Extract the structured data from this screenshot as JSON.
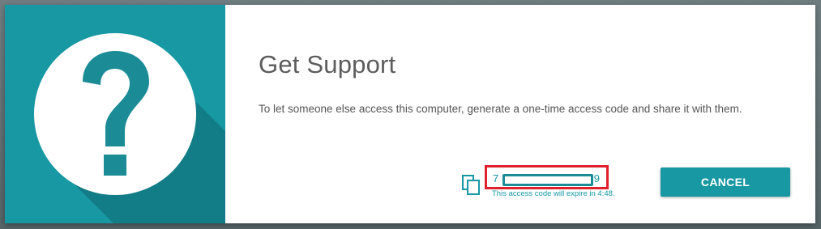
{
  "dialog": {
    "title": "Get Support",
    "description": "To let someone else access this computer, generate a one-time access code and share it with them.",
    "access_code": {
      "first_char": "7",
      "last_char": "9",
      "expire_text": "This access code will expire in 4:48."
    },
    "cancel_label": "CANCEL"
  },
  "icons": {
    "help": "help-question-icon",
    "copy": "copy-icon"
  },
  "colors": {
    "accent": "#1798a3",
    "accent_shadow": "#137d87",
    "highlight": "#e0202b",
    "title_text": "#5c5c5c",
    "body_text": "#555555"
  }
}
